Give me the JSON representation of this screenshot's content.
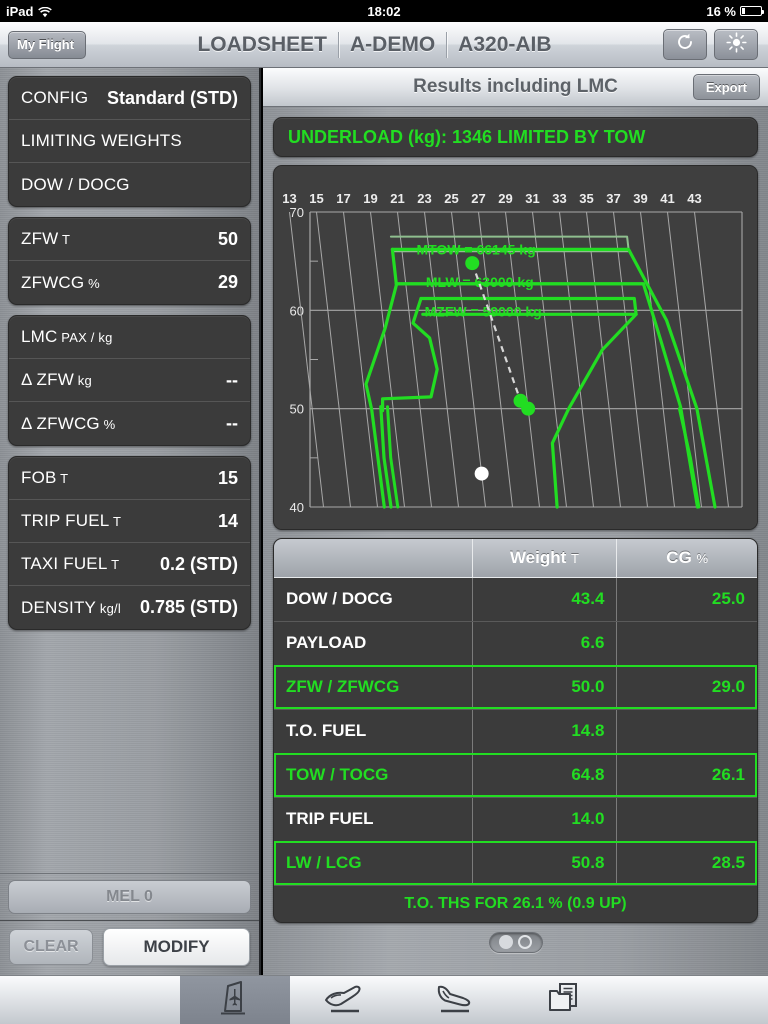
{
  "status_bar": {
    "device": "iPad",
    "wifi_icon": "wifi-icon",
    "time": "18:02",
    "battery_text": "16 %",
    "battery_percent": 16
  },
  "navbar": {
    "back_label": "My Flight",
    "title_segments": [
      "LOADSHEET",
      "A-DEMO",
      "A320-AIB"
    ],
    "refresh_icon": "refresh-icon",
    "brightness_icon": "brightness-icon"
  },
  "sidebar": {
    "groups": [
      {
        "rows": [
          {
            "label": "CONFIG",
            "sub": "",
            "value": "Standard (STD)"
          },
          {
            "label": "LIMITING WEIGHTS",
            "sub": "",
            "value": ""
          },
          {
            "label": "DOW / DOCG",
            "sub": "",
            "value": ""
          }
        ]
      },
      {
        "rows": [
          {
            "label": "ZFW",
            "sub": "T",
            "value": "50"
          },
          {
            "label": "ZFWCG",
            "sub": "%",
            "value": "29"
          }
        ]
      },
      {
        "rows": [
          {
            "label": "LMC",
            "sub": "PAX / kg",
            "value": ""
          },
          {
            "label": "Δ ZFW",
            "sub": "kg",
            "value": "--"
          },
          {
            "label": "Δ ZFWCG",
            "sub": "%",
            "value": "--"
          }
        ]
      },
      {
        "rows": [
          {
            "label": "FOB",
            "sub": "T",
            "value": "15"
          },
          {
            "label": "TRIP FUEL",
            "sub": "T",
            "value": "14"
          },
          {
            "label": "TAXI FUEL",
            "sub": "T",
            "value": "0.2 (STD)"
          },
          {
            "label": "DENSITY",
            "sub": "kg/l",
            "value": "0.785 (STD)"
          }
        ]
      }
    ],
    "mel_label": "MEL 0",
    "clear_label": "CLEAR",
    "modify_label": "MODIFY"
  },
  "results": {
    "header_title": "Results including LMC",
    "export_label": "Export",
    "underload_text": "UNDERLOAD (kg): 1346 LIMITED BY TOW",
    "columns": [
      "",
      "Weight",
      "CG"
    ],
    "column_units": [
      "",
      "T",
      "%"
    ],
    "rows": [
      {
        "label": "DOW / DOCG",
        "weight": "43.4",
        "cg": "25.0",
        "highlight": false
      },
      {
        "label": "PAYLOAD",
        "weight": "6.6",
        "cg": "",
        "highlight": false
      },
      {
        "label": "ZFW / ZFWCG",
        "weight": "50.0",
        "cg": "29.0",
        "highlight": true
      },
      {
        "label": "T.O. FUEL",
        "weight": "14.8",
        "cg": "",
        "highlight": false
      },
      {
        "label": "TOW / TOCG",
        "weight": "64.8",
        "cg": "26.1",
        "highlight": true
      },
      {
        "label": "TRIP FUEL",
        "weight": "14.0",
        "cg": "",
        "highlight": false
      },
      {
        "label": "LW / LCG",
        "weight": "50.8",
        "cg": "28.5",
        "highlight": true
      }
    ],
    "ths_text": "T.O. THS FOR 26.1 % (0.9 UP)"
  },
  "chart_data": {
    "type": "line",
    "title": "",
    "xlabel": "",
    "ylabel": "",
    "xlim": [
      12,
      44
    ],
    "ylim": [
      40,
      70
    ],
    "x_ticks": [
      13,
      15,
      17,
      19,
      21,
      23,
      25,
      27,
      29,
      31,
      33,
      35,
      37,
      39,
      41,
      43
    ],
    "y_ticks": [
      40,
      50,
      60,
      70
    ],
    "grid": true,
    "x_axis_position": "top",
    "annotations": [
      {
        "text": "MTOW = 66145 kg",
        "x": 26.5,
        "y": 66.2
      },
      {
        "text": "MLW = 63000 kg",
        "x": 26.5,
        "y": 62.9
      },
      {
        "text": "MZFW = 59000 kg",
        "x": 26.5,
        "y": 59.9
      }
    ],
    "limit_lines": [
      {
        "name": "MTOW",
        "value": 66145,
        "unit": "kg"
      },
      {
        "name": "MLW",
        "value": 63000,
        "unit": "kg"
      },
      {
        "name": "MZFW",
        "value": 59000,
        "unit": "kg"
      }
    ],
    "points": [
      {
        "name": "TOW",
        "cg": 26.1,
        "weight": 64.8,
        "color": "#22dd22"
      },
      {
        "name": "ZFW",
        "cg": 29.0,
        "weight": 50.0,
        "color": "#22dd22"
      },
      {
        "name": "LW",
        "cg": 28.5,
        "weight": 50.8,
        "color": "#22dd22"
      },
      {
        "name": "DOW",
        "cg": 25.0,
        "weight": 43.4,
        "color": "#ffffff"
      }
    ],
    "colors": {
      "envelope": "#22dd22",
      "grid": "#a8a8a8",
      "background": "#3f3f3f"
    }
  },
  "pager": {
    "filled_dot": "page-dot-filled",
    "empty_dot": "page-dot-empty"
  },
  "tabbar": {
    "tabs": [
      {
        "icon": "aircraft-tail-icon",
        "active": true
      },
      {
        "icon": "takeoff-icon",
        "active": false
      },
      {
        "icon": "landing-icon",
        "active": false
      },
      {
        "icon": "documents-icon",
        "active": false
      }
    ]
  }
}
